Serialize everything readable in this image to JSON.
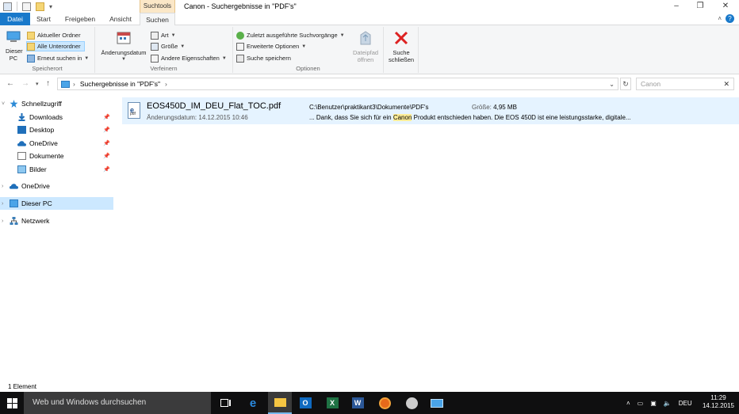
{
  "window": {
    "title": "Canon - Suchergebnisse in \"PDF's\"",
    "context_tab_header": "Suchtools",
    "controls": {
      "minimize": "–",
      "maximize": "❐",
      "close": "✕"
    }
  },
  "tabs": [
    {
      "label": "Datei"
    },
    {
      "label": "Start"
    },
    {
      "label": "Freigeben"
    },
    {
      "label": "Ansicht"
    },
    {
      "label": "Suchen"
    }
  ],
  "ribbon": {
    "speicherort": {
      "label": "Speicherort",
      "dieser_pc": "Dieser PC",
      "aktueller_ordner": "Aktueller Ordner",
      "alle_unterordner": "Alle Unterordner",
      "erneut_suchen": "Erneut suchen in"
    },
    "verfeinern": {
      "label": "Verfeinern",
      "aenderungsdatum": "Änderungsdatum",
      "art": "Art",
      "groesse": "Größe",
      "andere": "Andere Eigenschaften"
    },
    "optionen": {
      "label": "Optionen",
      "zuletzt": "Zuletzt ausgeführte Suchvorgänge",
      "erweitert": "Erweiterte Optionen",
      "speichern": "Suche speichern",
      "dateipfad_line1": "Dateipfad",
      "dateipfad_line2": "öffnen"
    },
    "schliessen": {
      "line1": "Suche",
      "line2": "schließen"
    }
  },
  "address": {
    "path": "Suchergebnisse in \"PDF's\"",
    "search_value": "Canon"
  },
  "nav": {
    "schnellzugriff": "Schnellzugriff",
    "downloads": "Downloads",
    "desktop": "Desktop",
    "onedrive_quick": "OneDrive",
    "dokumente": "Dokumente",
    "bilder": "Bilder",
    "onedrive": "OneDrive",
    "dieser_pc": "Dieser PC",
    "netzwerk": "Netzwerk"
  },
  "result": {
    "name": "EOS450D_IM_DEU_Flat_TOC.pdf",
    "date_label": "Änderungsdatum:",
    "date": "14.12.2015 10:46",
    "path": "C:\\Benutzer\\praktikant3\\Dokumente\\PDF's",
    "size_label": "Größe:",
    "size": "4,95 MB",
    "snippet_before": "... Dank, dass Sie sich für ein ",
    "snippet_hit": "Canon",
    "snippet_after": " Produkt entschieden haben. Die EOS 450D ist eine leistungsstarke, digitale..."
  },
  "status": {
    "count": "1 Element"
  },
  "taskbar": {
    "search_placeholder": "Web und Windows durchsuchen",
    "language": "DEU",
    "time": "11:29",
    "date": "14.12.2015"
  }
}
